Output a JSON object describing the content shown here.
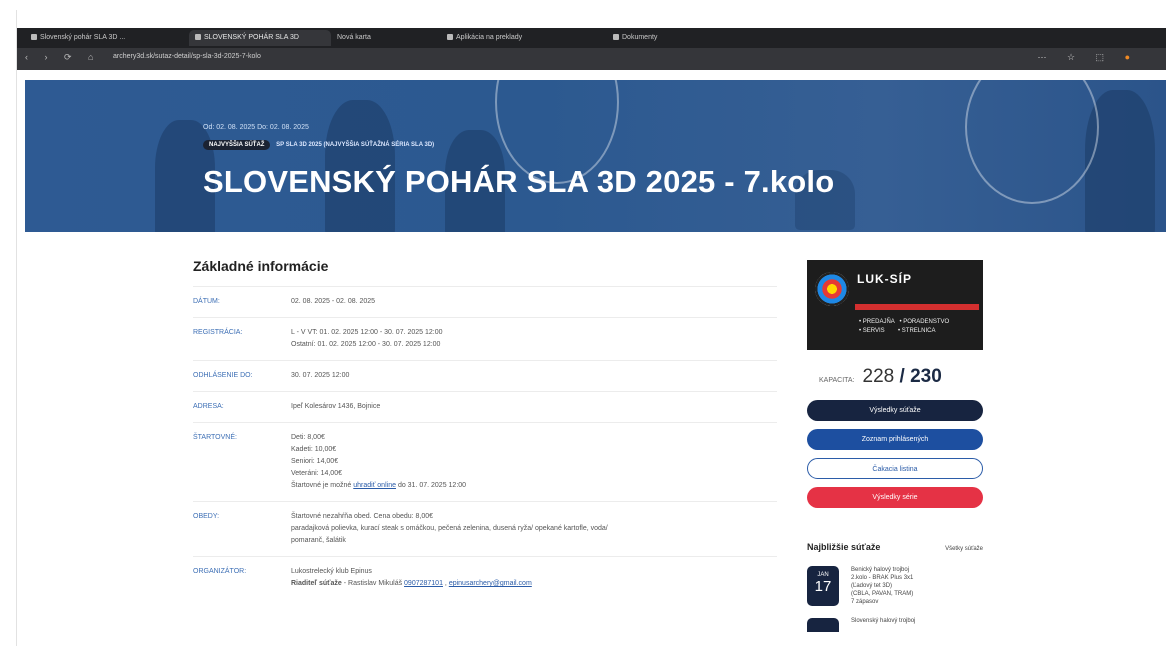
{
  "browser": {
    "tabs": [
      "Slovenský pohár SLA 3D ...",
      "SLOVENSKÝ POHÁR SLA 3D",
      "Nová karta",
      "Aplikácia na preklady",
      "Dokumenty"
    ],
    "url": "archery3d.sk/sutaz-detail/sp-sla-3d-2025-7-kolo",
    "nav": "‹ › ⟳ ⌂",
    "ext_icons": "⋯ ☆ ⬚"
  },
  "hero": {
    "dates": "Od: 02. 08. 2025    Do: 02. 08. 2025",
    "badge_type": "NAJVYŠŠIA SÚŤAŽ",
    "badge_link": "SP SLA 3D 2025 (NAJVYŠŠIA SÚŤAŽNÁ SÉRIA SLA 3D)",
    "title": "SLOVENSKÝ POHÁR SLA 3D 2025 - 7.kolo"
  },
  "info": {
    "heading": "Základné informácie",
    "rows": [
      {
        "label": "DÁTUM:",
        "lines": [
          "02. 08. 2025 - 02. 08. 2025"
        ]
      },
      {
        "label": "REGISTRÁCIA:",
        "lines": [
          "L - V VT: 01. 02. 2025 12:00 - 30. 07. 2025 12:00",
          "Ostatní: 01. 02. 2025 12:00 - 30. 07. 2025 12:00"
        ]
      },
      {
        "label": "ODHLÁSENIE DO:",
        "lines": [
          "30. 07. 2025 12:00"
        ]
      },
      {
        "label": "ADRESA:",
        "lines": [
          "Ipeľ Kolesárov 1436, Bojnice"
        ]
      },
      {
        "label": "ŠTARTOVNÉ:",
        "lines": [
          "Deti: 8,00€",
          "Kadeti: 10,00€",
          "Seniori: 14,00€",
          "Veteráni: 14,00€"
        ],
        "extra_before": "Štartovné je možné",
        "extra_link": "uhradiť online",
        "extra_after": "do 31. 07. 2025 12:00"
      },
      {
        "label": "OBEDY:",
        "lines": [
          "Štartovné nezahŕňa obed. Cena obedu: 8,00€",
          "paradajková polievka, kurací steak s omáčkou, pečená zelenina, dusená ryža/ opekané kartofle, voda/",
          "pomaranč, šalátik"
        ]
      },
      {
        "label": "ORGANIZÁTOR:",
        "lines": [
          "Lukostrelecký klub Epinus"
        ],
        "contact_label": "Riaditeľ súťaže",
        "contact_person": " - Rastislav Mikuláš ",
        "contact_phone": "0907287101",
        "contact_email": "epinusarchery@gmail.com"
      }
    ]
  },
  "sidebar": {
    "ad": {
      "logo": "LUK-SÍP",
      "services": "• PREDAJŇA   • PORADENSTVO\n• SERVIS        • STRELNICA"
    },
    "capacity_label": "KAPACITA:",
    "capacity_current": "228",
    "capacity_sep": " / ",
    "capacity_max": "230",
    "buttons": {
      "results_comp": "Výsledky súťaže",
      "registered": "Zoznam prihlásených",
      "waiting": "Čakacia listina",
      "results_series": "Výsledky série"
    },
    "next_title": "Najbližšie súťaže",
    "next_all": "Všetky súťaže",
    "events": [
      {
        "month": "JAN",
        "day": "17",
        "text": [
          "Benický halový trojboj",
          "2.kolo - BRAK Plus 3x1",
          "(Ľadový tet 3D)",
          "(CBLA, PAVAN, TRAM)",
          "7 zápasov"
        ]
      },
      {
        "month": "",
        "day": "",
        "text": [
          "Slovenský halový trojboj"
        ]
      }
    ]
  }
}
